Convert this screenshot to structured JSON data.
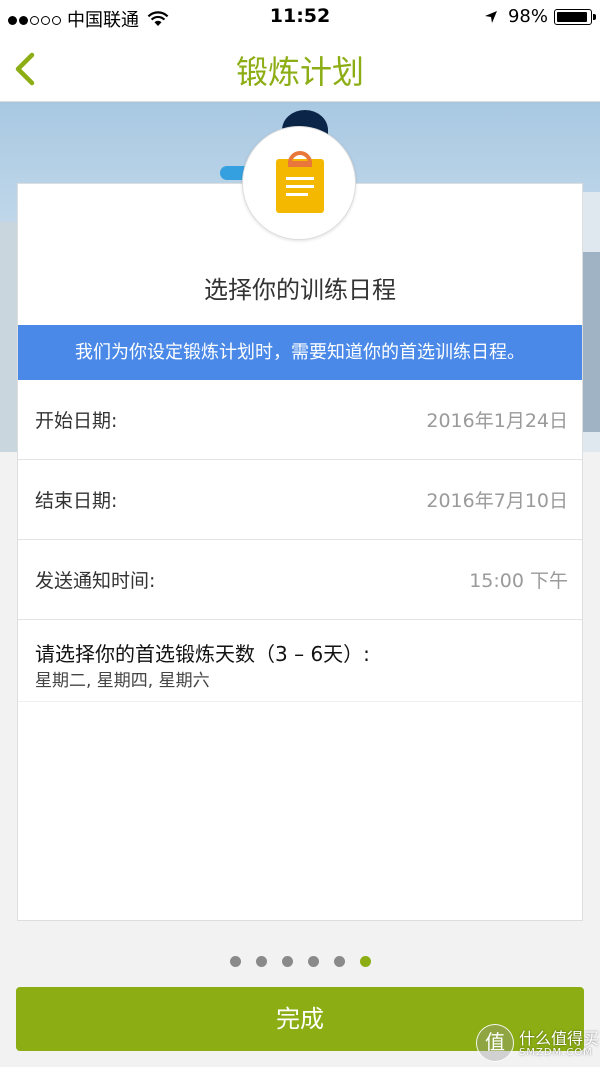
{
  "status_bar": {
    "carrier": "中国联通",
    "time": "11:52",
    "battery": "98%",
    "signal_bars": 2
  },
  "nav": {
    "title": "锻炼计划",
    "back_icon": "chevron-left-icon"
  },
  "colors": {
    "accent": "#8cae14",
    "banner": "#4a89e8",
    "icon_gold": "#f5b800",
    "icon_orange": "#e9763b"
  },
  "card": {
    "icon": "clipboard-icon",
    "title": "选择你的训练日程",
    "banner": "我们为你设定锻炼计划时，需要知道你的首选训练日程。",
    "rows": [
      {
        "label": "开始日期:",
        "value": "2016年1月24日"
      },
      {
        "label": "结束日期:",
        "value": "2016年7月10日"
      },
      {
        "label": "发送通知时间:",
        "value": "15:00 下午"
      }
    ],
    "days_question": "请选择你的首选锻炼天数（3 – 6天）:",
    "days_value": "星期二, 星期四, 星期六"
  },
  "pager": {
    "count": 6,
    "active_index": 5
  },
  "done_button": "完成",
  "watermark": {
    "glyph": "值",
    "line1": "什么值得买",
    "line2": "SMZDM.COM"
  }
}
